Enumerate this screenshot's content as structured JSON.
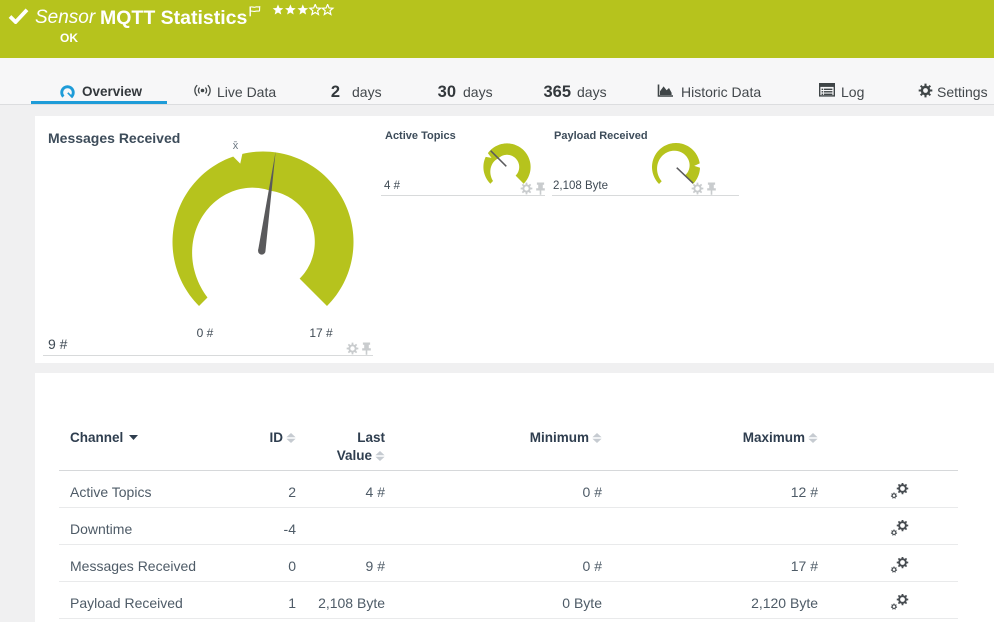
{
  "colors": {
    "green": "#b6c31d",
    "blue": "#1e9cd8",
    "needle": "#5a5a5c"
  },
  "header": {
    "type_label": "Sensor",
    "title": "MQTT Statistics",
    "status": "OK",
    "stars_filled": 3,
    "stars_total": 5
  },
  "tabs": [
    {
      "label": "Overview",
      "active": true
    },
    {
      "label": "Live Data"
    },
    {
      "prefix": "2",
      "label": "days"
    },
    {
      "prefix": "30",
      "label": "days"
    },
    {
      "prefix": "365",
      "label": "days"
    },
    {
      "label": "Historic Data"
    },
    {
      "label": "Log"
    },
    {
      "label": "Settings"
    }
  ],
  "gauges": {
    "primary": {
      "title": "Messages Received",
      "value": 9,
      "min": 0,
      "max": 17,
      "value_label": "9 #",
      "min_label": "0 #",
      "max_label": "17 #",
      "avg_fraction": 0.44,
      "mean_marker": "x̄"
    },
    "secondary": [
      {
        "title": "Active Topics",
        "value": 4,
        "min": 0,
        "max": 12,
        "value_label": "4 #",
        "avg_fraction": 0.28
      },
      {
        "title": "Payload Received",
        "value": 2108,
        "min": 0,
        "max": 2120,
        "value_label": "2,108 Byte",
        "avg_fraction": 0.82
      }
    ]
  },
  "table": {
    "columns": {
      "channel": "Channel",
      "id": "ID",
      "last": "Last Value",
      "min": "Minimum",
      "max": "Maximum"
    },
    "rows": [
      {
        "channel": "Active Topics",
        "id": "2",
        "last": "4 #",
        "min": "0 #",
        "max": "12 #"
      },
      {
        "channel": "Downtime",
        "id": "-4",
        "last": "",
        "min": "",
        "max": ""
      },
      {
        "channel": "Messages Received",
        "id": "0",
        "last": "9 #",
        "min": "0 #",
        "max": "17 #"
      },
      {
        "channel": "Payload Received",
        "id": "1",
        "last": "2,108 Byte",
        "min": "0 Byte",
        "max": "2,120 Byte"
      }
    ]
  }
}
